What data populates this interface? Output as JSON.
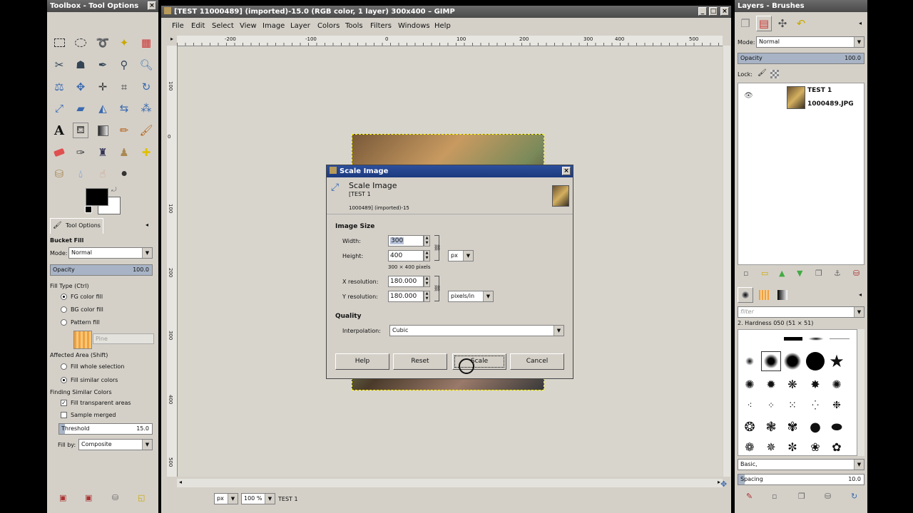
{
  "toolbox": {
    "title": "Toolbox - Tool Options",
    "tool_options_tab": "Tool Options",
    "tool_name": "Bucket Fill",
    "mode_label": "Mode:",
    "mode_value": "Normal",
    "opacity_label": "Opacity",
    "opacity_value": "100.0",
    "fill_type_label": "Fill Type  (Ctrl)",
    "fill_options": [
      "FG color fill",
      "BG color fill",
      "Pattern fill"
    ],
    "pattern_name": "Pine",
    "affected_area_label": "Affected Area  (Shift)",
    "affected_options": [
      "Fill whole selection",
      "Fill similar colors"
    ],
    "finding_label": "Finding Similar Colors",
    "fill_transparent_label": "Fill transparent areas",
    "sample_merged_label": "Sample merged",
    "threshold_label": "Threshold",
    "threshold_value": "15.0",
    "fill_by_label": "Fill by:",
    "fill_by_value": "Composite"
  },
  "image_window": {
    "title": "[TEST 11000489] (imported)-15.0 (RGB color, 1 layer) 300x400 – GIMP",
    "menu": [
      "File",
      "Edit",
      "Select",
      "View",
      "Image",
      "Layer",
      "Colors",
      "Tools",
      "Filters",
      "Windows",
      "Help"
    ],
    "ruler_h": [
      "-200",
      "-100",
      "0",
      "100",
      "200",
      "300",
      "400",
      "500"
    ],
    "ruler_v": [
      "100",
      "0",
      "100",
      "200",
      "300",
      "400",
      "500"
    ],
    "unit": "px",
    "zoom": "100 %",
    "status": "TEST 1"
  },
  "dialog": {
    "title": "Scale Image",
    "header_title": "Scale Image",
    "header_sub1": "[TEST 1",
    "header_sub2": "1000489] (imported)-15",
    "image_size_label": "Image Size",
    "width_label": "Width:",
    "width_value": "300",
    "height_label": "Height:",
    "height_value": "400",
    "unit": "px",
    "pixels_info": "300 × 400 pixels",
    "xres_label": "X resolution:",
    "xres_value": "180.000",
    "yres_label": "Y resolution:",
    "yres_value": "180.000",
    "res_unit": "pixels/in",
    "quality_label": "Quality",
    "interp_label": "Interpolation:",
    "interp_value": "Cubic",
    "buttons": {
      "help": "Help",
      "reset": "Reset",
      "scale": "Scale",
      "cancel": "Cancel"
    }
  },
  "layers": {
    "title": "Layers - Brushes",
    "mode_label": "Mode:",
    "mode_value": "Normal",
    "opacity_label": "Opacity",
    "opacity_value": "100.0",
    "lock_label": "Lock:",
    "layer_name_1": "TEST 1",
    "layer_name_2": "1000489.JPG",
    "filter_placeholder": "filter",
    "brush_name": "2. Hardness 050 (51 × 51)",
    "brush_tag": "Basic,",
    "spacing_label": "Spacing",
    "spacing_value": "10.0"
  },
  "colors": {
    "fg": "#000000",
    "bg": "#ffffff",
    "title_blue": "#1b3a7e",
    "panel": "#d4d0c8"
  }
}
